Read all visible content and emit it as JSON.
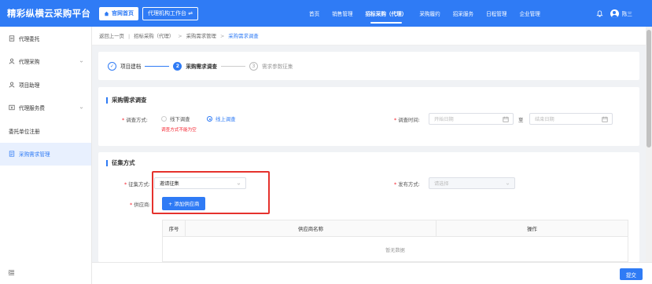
{
  "header": {
    "brand": "精彩纵横云采购平台",
    "home_button": "官网首页",
    "workbench_button": "代理机构工作台 ⇌",
    "nav": [
      {
        "label": "首页",
        "active": false
      },
      {
        "label": "销售管理",
        "active": false
      },
      {
        "label": "招标采购（代理）",
        "active": true
      },
      {
        "label": "采购履约",
        "active": false
      },
      {
        "label": "招采服务",
        "active": false
      },
      {
        "label": "日程管理",
        "active": false
      },
      {
        "label": "企业管理",
        "active": false
      }
    ],
    "user_name": "陈三"
  },
  "sidebar": {
    "items": [
      {
        "label": "代理委托",
        "icon": "document-icon",
        "has_chevron": false,
        "active": false
      },
      {
        "label": "代理采购",
        "icon": "user-icon",
        "has_chevron": true,
        "active": false
      },
      {
        "label": "项目助理",
        "icon": "user-icon",
        "has_chevron": false,
        "active": false
      },
      {
        "label": "代理服务费",
        "icon": "money-icon",
        "has_chevron": true,
        "active": false
      },
      {
        "label": "委托单位注册",
        "icon": "",
        "has_chevron": false,
        "active": false
      },
      {
        "label": "采购需求管理",
        "icon": "list-icon",
        "has_chevron": false,
        "active": true
      }
    ]
  },
  "breadcrumb": {
    "back": "返回上一页",
    "items": [
      "招标采购（代理）",
      "采购需求管理",
      "采购需求调查"
    ]
  },
  "steps": [
    {
      "num": "✓",
      "label": "项目建档",
      "state": "done"
    },
    {
      "num": "2",
      "label": "采购需求调查",
      "state": "current"
    },
    {
      "num": "3",
      "label": "需求参数征集",
      "state": "todo"
    }
  ],
  "survey": {
    "title": "采购需求调查",
    "method_label": "调查方式:",
    "method_options": [
      "线下调查",
      "线上调查"
    ],
    "method_selected": 1,
    "method_error": "调查方式不能为空",
    "time_label": "调查时间:",
    "start_placeholder": "开始日期",
    "to_text": "至",
    "end_placeholder": "结束日期"
  },
  "collect": {
    "title": "征集方式",
    "method_label": "征集方式:",
    "method_value": "邀请征集",
    "publish_label": "发布方式:",
    "publish_placeholder": "请选择",
    "supplier_label": "供应商:",
    "add_supplier_button": "+ 添加供应商",
    "table": {
      "columns": [
        "序号",
        "供应商名称",
        "操作"
      ],
      "empty_text": "暂无数据"
    }
  },
  "footer": {
    "submit_button": "提交"
  },
  "colors": {
    "primary": "#2f7bf5",
    "error": "#f5222d",
    "highlight_box": "#e5322d"
  }
}
